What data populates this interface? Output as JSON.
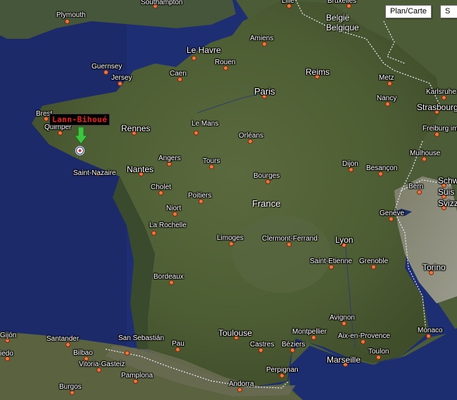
{
  "map_controls": {
    "plan_carte_label": "Plan/Carte",
    "satellite_label": "S"
  },
  "marker": {
    "label": "Lann-Bihoué",
    "color": "#ff1a1a"
  },
  "countries": [
    {
      "id": "belgique",
      "lines": [
        "België",
        "Belgique"
      ]
    },
    {
      "id": "france",
      "lines": [
        "France"
      ]
    }
  ],
  "cities": [
    "Plymouth",
    "Southampton",
    "Lille",
    "Bruxelles",
    "Amiens",
    "Le Havre",
    "Rouen",
    "Guernsey",
    "Jersey",
    "Caen",
    "Reims",
    "Metz",
    "Karlsruhe",
    "Paris",
    "Nancy",
    "Strasbourg",
    "Brest",
    "Quimper",
    "Rennes",
    "Le Mans",
    "Orléans",
    "Freiburg im Breisgau",
    "Dijon",
    "Besançon",
    "Mulhouse",
    "Angers",
    "Tours",
    "Saint-Nazaire",
    "Nantes",
    "Bourges",
    "Bern",
    "Schw",
    "Suis",
    "Svizz",
    "Cholet",
    "Poitiers",
    "Niort",
    "Genève",
    "La Rochelle",
    "Limoges",
    "Clermont-Ferrand",
    "Lyon",
    "Saint-Etienne",
    "Grenoble",
    "Torino",
    "Bordeaux",
    "Avignon",
    "Toulouse",
    "Montpellier",
    "Aix-en-Provence",
    "Monaco",
    "Gijón",
    "Santander",
    "San Sebastián",
    "Pau",
    "Castres",
    "Béziers",
    "Marseille",
    "Toulon",
    "iedo",
    "Bilbao",
    "Vitoria-Gasteiz",
    "Pamplona",
    "Perpignan",
    "Andorra",
    "Burgos"
  ]
}
